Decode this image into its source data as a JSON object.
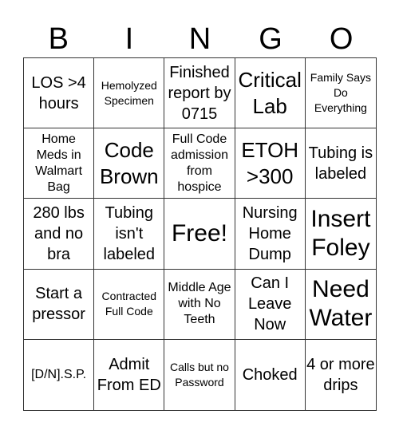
{
  "header": [
    "B",
    "I",
    "N",
    "G",
    "O"
  ],
  "cells": [
    {
      "text": "LOS >4 hours",
      "size": "s-md"
    },
    {
      "text": "Hemolyzed Specimen",
      "size": "s-xs"
    },
    {
      "text": "Finished report by 0715",
      "size": "s-md"
    },
    {
      "text": "Critical Lab",
      "size": "s-lg"
    },
    {
      "text": "Family Says Do Everything",
      "size": "s-xs"
    },
    {
      "text": "Home Meds in Walmart Bag",
      "size": "s-sm"
    },
    {
      "text": "Code Brown",
      "size": "s-lg"
    },
    {
      "text": "Full Code admission from hospice",
      "size": "s-sm"
    },
    {
      "text": "ETOH >300",
      "size": "s-lg"
    },
    {
      "text": "Tubing is labeled",
      "size": "s-md"
    },
    {
      "text": "280 lbs and no bra",
      "size": "s-md"
    },
    {
      "text": "Tubing isn't labeled",
      "size": "s-md"
    },
    {
      "text": "Free!",
      "size": "s-xl"
    },
    {
      "text": "Nursing Home Dump",
      "size": "s-md"
    },
    {
      "text": "Insert Foley",
      "size": "s-xl"
    },
    {
      "text": "Start a pressor",
      "size": "s-md"
    },
    {
      "text": "Contracted Full Code",
      "size": "s-xs"
    },
    {
      "text": "Middle Age with No Teeth",
      "size": "s-sm"
    },
    {
      "text": "Can I Leave Now",
      "size": "s-md"
    },
    {
      "text": "Need Water",
      "size": "s-xl"
    },
    {
      "text": "[D/N].S.P.",
      "size": "s-sm"
    },
    {
      "text": "Admit From ED",
      "size": "s-md"
    },
    {
      "text": "Calls but no Password",
      "size": "s-xs"
    },
    {
      "text": "Choked",
      "size": "s-md"
    },
    {
      "text": "4 or more drips",
      "size": "s-md"
    }
  ]
}
